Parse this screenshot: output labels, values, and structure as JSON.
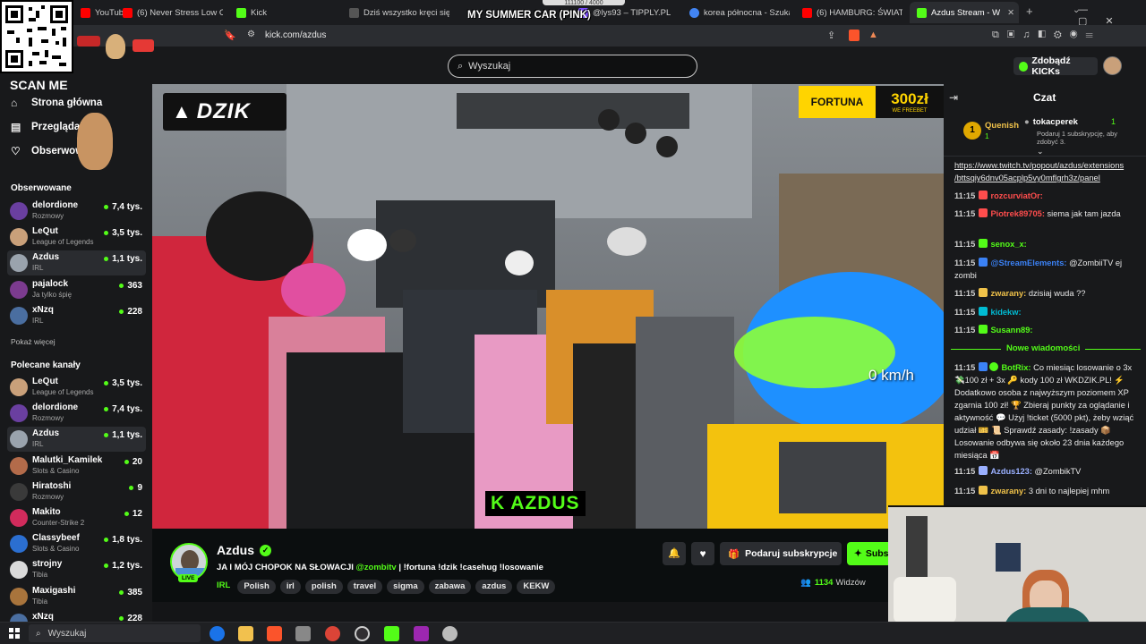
{
  "browser": {
    "tabs": [
      {
        "label": "YouTub",
        "color": "#ff0000"
      },
      {
        "label": "(6) Never Stress Low Cortis",
        "color": "#ff0000"
      },
      {
        "label": "Kick",
        "color": "#53fc18"
      },
      {
        "label": "Dziś wszystko kręci się wo",
        "color": "#555"
      },
      {
        "label": "@lys93 – TIPPLY.PL",
        "color": "#7c4dff"
      },
      {
        "label": "korea północna - Szukaj w",
        "color": "#4285f4"
      },
      {
        "label": "(6) HAMBURG: ŚWIAT UZA",
        "color": "#ff0000"
      },
      {
        "label": "Azdus Stream - W",
        "color": "#53fc18"
      }
    ],
    "url": "kick.com/azdus"
  },
  "overlay": {
    "scan_me": "SCAN ME",
    "song_title": "MY SUMMER CAR (PINK)",
    "goal": "111100 / 4000"
  },
  "header": {
    "search_placeholder": "Wyszukaj",
    "kicks_button": "Zdobądź KICKs"
  },
  "sidebar": {
    "nav": [
      {
        "label": "Strona główna",
        "icon": "home-icon",
        "glyph": "⌂"
      },
      {
        "label": "Przeglądaj",
        "icon": "browse-icon",
        "glyph": "▤"
      },
      {
        "label": "Obserwowane",
        "icon": "heart-icon",
        "glyph": "♡"
      }
    ],
    "followed_title": "Obserwowane",
    "followed": [
      {
        "name": "delordione",
        "category": "Rozmowy",
        "viewers": "7,4 tys.",
        "color": "#6a3fa0"
      },
      {
        "name": "LeQut",
        "category": "League of Legends",
        "viewers": "3,5 tys.",
        "color": "#c9a07a"
      },
      {
        "name": "Azdus",
        "category": "IRL",
        "viewers": "1,1 tys.",
        "color": "#9aa3ad"
      },
      {
        "name": "pajalock",
        "category": "Ja tylko śpię",
        "viewers": "363",
        "color": "#7c3b8f"
      },
      {
        "name": "xNzq",
        "category": "IRL",
        "viewers": "228",
        "color": "#4a6ea0"
      }
    ],
    "show_more": "Pokaż więcej",
    "recommended_title": "Polecane kanały",
    "recommended": [
      {
        "name": "LeQut",
        "category": "League of Legends",
        "viewers": "3,5 tys.",
        "color": "#c9a07a"
      },
      {
        "name": "delordione",
        "category": "Rozmowy",
        "viewers": "7,4 tys.",
        "color": "#6a3fa0"
      },
      {
        "name": "Azdus",
        "category": "IRL",
        "viewers": "1,1 tys.",
        "color": "#9aa3ad"
      },
      {
        "name": "Malutki_Kamilek",
        "category": "Slots & Casino",
        "viewers": "20",
        "color": "#b36b4a"
      },
      {
        "name": "Hiratoshi",
        "category": "Rozmowy",
        "viewers": "9",
        "color": "#3a3a3a"
      },
      {
        "name": "Makito",
        "category": "Counter-Strike 2",
        "viewers": "12",
        "color": "#d12b5c"
      },
      {
        "name": "Classybeef",
        "category": "Slots & Casino",
        "viewers": "1,8 tys.",
        "color": "#2b6fd1"
      },
      {
        "name": "strojny",
        "category": "Tibia",
        "viewers": "1,2 tys.",
        "color": "#dadada"
      },
      {
        "name": "Maxigashi",
        "category": "Tibia",
        "viewers": "385",
        "color": "#a8743c"
      },
      {
        "name": "xNzq",
        "category": "",
        "viewers": "228",
        "color": "#4a6ea0"
      }
    ]
  },
  "video": {
    "sponsor_left": "DZIK",
    "sponsor_right": "FORTUNA",
    "sponsor_amount": "300zł",
    "sponsor_sub": "WE FREEBET",
    "speed": "0 km/h",
    "watermark": "K AZDUS"
  },
  "stream": {
    "name": "Azdus",
    "live": "LIVE",
    "title_prefix": "JA I MÓJ CHOPOK NA SŁOWACJI",
    "title_mention": "@zombitv",
    "title_suffix": "| !fortuna !dzik !casehug !losowanie",
    "category": "IRL",
    "tags": [
      "Polish",
      "irl",
      "polish",
      "travel",
      "sigma",
      "zabawa",
      "azdus",
      "KEKW"
    ],
    "viewers": "1134",
    "viewers_label": "Widzów",
    "gift_button": "Podaruj subskrypcje",
    "subscribe_button": "Subs"
  },
  "chat": {
    "title": "Czat",
    "pinned": {
      "rank": "1",
      "user1": "Quenish",
      "user1_count": "1",
      "user2": "tokacperek",
      "user2_count": "1",
      "note": "Podaruj 1 subskrypcję, aby zdobyć 3."
    },
    "link_line1": "https://www.twitch.tv/popout/azdus/extensions",
    "link_line2": "/bttsqiy6dnv05acplp5vy0mflgrh3z/panel",
    "messages": [
      {
        "time": "11:15",
        "user": "rozcurviatOr:",
        "text": "",
        "color": "#ff4d4d"
      },
      {
        "time": "11:15",
        "user": "Piotrek89705:",
        "text": "siema jak tam jazda",
        "color": "#ff4d4d"
      },
      {
        "time": "11:15",
        "user": "senox_x:",
        "text": "",
        "color": "#53fc18"
      },
      {
        "time": "11:15",
        "user": "@StreamElements:",
        "text": "@ZombiiTV ej zombi",
        "color": "#3b82f6"
      },
      {
        "time": "11:15",
        "user": "zwarany:",
        "text": "dzisiaj wuda ??",
        "color": "#f0c24a"
      },
      {
        "time": "11:15",
        "user": "kidekw:",
        "text": "",
        "color": "#00bcd4"
      },
      {
        "time": "11:15",
        "user": "Susann89:",
        "text": "",
        "color": "#53fc18"
      }
    ],
    "new_messages": "Nowe wiadomości",
    "botrix": {
      "time": "11:15",
      "user": "BotRix:",
      "text": "Co miesiąc losowanie o 3x 💸100 zł + 3x 🔑 kody 100 zł WKDZIK.PL! ⚡ Dodatkowo osoba z najwyższym poziomem XP zgarnia 100 zł! 🏆 Zbieraj punkty za oglądanie i aktywność 💬 Użyj !ticket (5000 pkt), żeby wziąć udział 🎫 📜 Sprawdź zasady: !zasady 📦 Losowanie odbywa się około 23 dnia każdego miesiąca 📅"
    },
    "after": [
      {
        "time": "11:15",
        "user": "Azdus123:",
        "text": "@ZombikTV",
        "color": "#9ab0ff"
      },
      {
        "time": "11:15",
        "user": "zwarany:",
        "text": "3 dni to najlepiej mhm",
        "color": "#f0c24a"
      }
    ]
  },
  "taskbar": {
    "search_label": "Wyszukaj"
  },
  "colors": {
    "kick_green": "#53fc18",
    "bg": "#0b0e0f",
    "panel": "#18191b"
  }
}
